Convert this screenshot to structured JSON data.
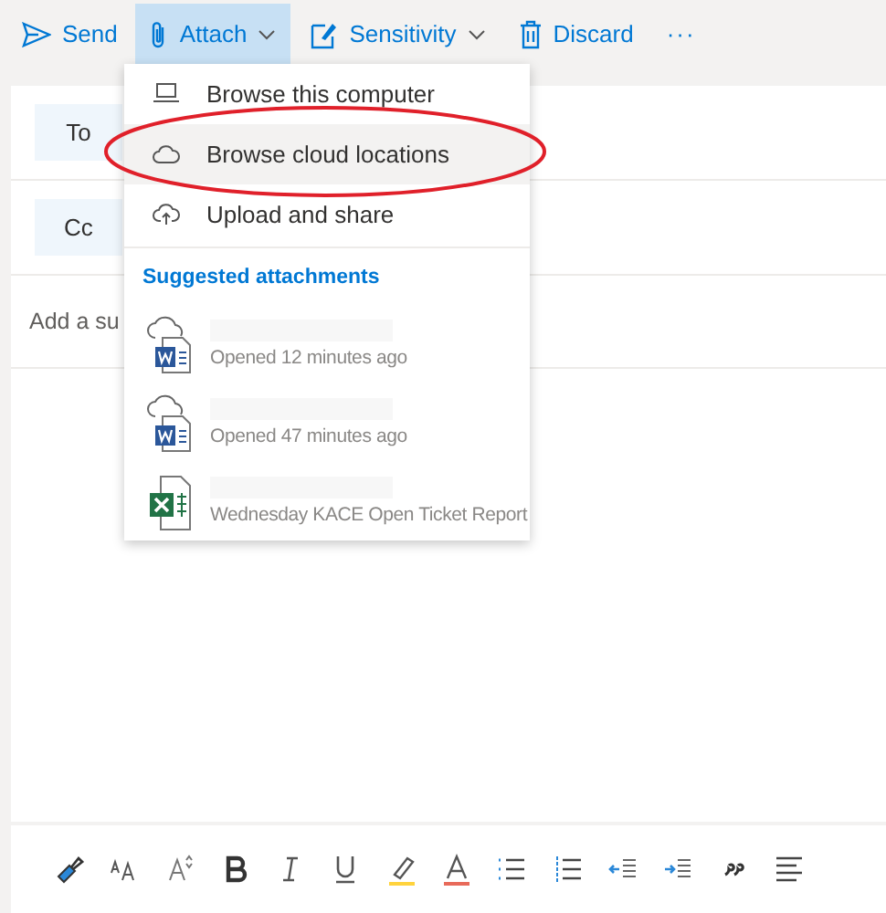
{
  "toolbar": [
    {
      "kind": "send",
      "label": "Send",
      "selected": false,
      "caret": false
    },
    {
      "kind": "attach",
      "label": "Attach",
      "selected": true,
      "caret": true
    },
    {
      "kind": "sensitivity",
      "label": "Sensitivity",
      "selected": false,
      "caret": true
    },
    {
      "kind": "discard",
      "label": "Discard",
      "selected": false,
      "caret": false
    }
  ],
  "more": "···",
  "recipients": [
    {
      "label": "To"
    },
    {
      "label": "Cc"
    }
  ],
  "subject": {
    "placeholder": "Add a su"
  },
  "attach_menu": {
    "items": [
      {
        "kind": "computer",
        "label": "Browse this computer",
        "selected": false
      },
      {
        "kind": "cloud",
        "label": "Browse cloud locations",
        "selected": true
      },
      {
        "kind": "upload",
        "label": "Upload and share",
        "selected": false
      }
    ],
    "suggested_heading": "Suggested attachments",
    "files": [
      {
        "kind": "word-cloud",
        "subtitle": "Opened 12 minutes ago"
      },
      {
        "kind": "word-cloud",
        "subtitle": "Opened 47 minutes ago"
      },
      {
        "kind": "excel",
        "subtitle": "Wednesday KACE Open Ticket Report"
      }
    ]
  },
  "annotation": {
    "kind": "ellipse"
  },
  "format_tools": [
    {
      "kind": "painter"
    },
    {
      "kind": "font-size"
    },
    {
      "kind": "grow"
    },
    {
      "kind": "bold"
    },
    {
      "kind": "italic"
    },
    {
      "kind": "underline"
    },
    {
      "kind": "highlight"
    },
    {
      "kind": "font-color"
    },
    {
      "kind": "bullets"
    },
    {
      "kind": "numbering"
    },
    {
      "kind": "outdent"
    },
    {
      "kind": "indent"
    },
    {
      "kind": "quote"
    },
    {
      "kind": "align"
    }
  ]
}
